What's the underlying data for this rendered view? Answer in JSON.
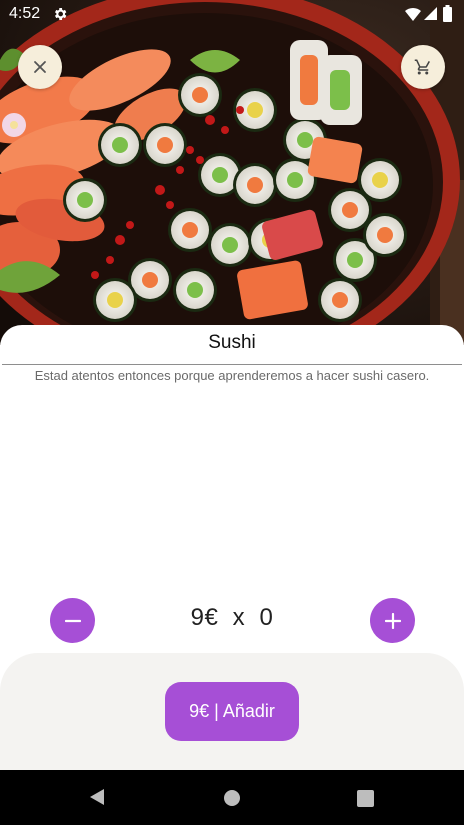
{
  "status_bar": {
    "time": "4:52",
    "icons": [
      "settings-icon",
      "wifi-icon",
      "signal-icon",
      "battery-icon"
    ]
  },
  "top_buttons": {
    "close_icon": "close-icon",
    "cart_icon": "cart-icon"
  },
  "product": {
    "title": "Sushi",
    "description": "Estad atentos entonces porque aprenderemos a hacer sushi casero.",
    "image": "sushi-platter-image"
  },
  "quantity": {
    "price": "9€",
    "times": "x",
    "count": "0",
    "decrement_icon": "minus-icon",
    "increment_icon": "plus-icon"
  },
  "cta": {
    "label": "9€ | Añadir"
  },
  "colors": {
    "accent": "#a64fd6",
    "round_button_bg": "#f6eedb",
    "bottom_panel_bg": "#f4f3f1"
  },
  "nav": {
    "icons": [
      "back-icon",
      "home-icon",
      "recents-icon"
    ]
  }
}
